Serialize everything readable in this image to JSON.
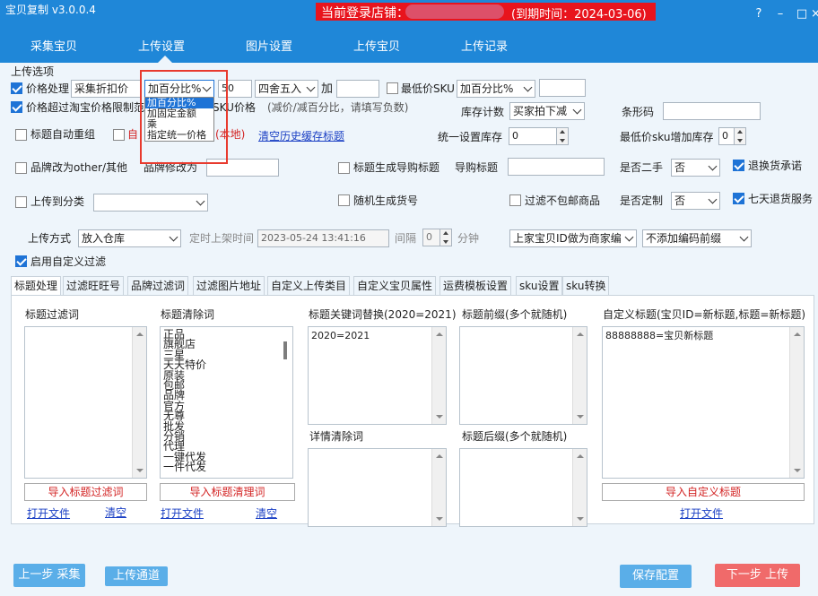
{
  "app": {
    "title": "宝贝复制 v3.0.0.4",
    "login_prefix": "当前登录店铺：",
    "login_expire": "(到期时间：2024-03-06)"
  },
  "nav": [
    "采集宝贝",
    "上传设置",
    "图片设置",
    "上传宝贝",
    "上传记录"
  ],
  "section": "上传选项",
  "price": {
    "label": "价格处理",
    "mode": "采集折扣价",
    "calc": "加百分比%",
    "value": "50",
    "round": "四舍五入",
    "plus_label": "加",
    "plus_value": ""
  },
  "min_sku": {
    "label": "最低价SKU",
    "calc": "加百分比%",
    "value": ""
  },
  "limit": {
    "label_a": "价格超过淘宝价格限制范",
    "label_b": "SKU价格",
    "hint": "(减价/减百分比，请填写负数)"
  },
  "stock": {
    "label": "库存计数",
    "value": "买家拍下减"
  },
  "barcode": {
    "label": "条形码",
    "value": ""
  },
  "dropdown": [
    "加百分比%",
    "加固定金额",
    "乘",
    "指定统一价格"
  ],
  "title_regroup": "标题自动重组",
  "hidden_label": "自",
  "hidden_local": "(本地)",
  "clear_history": "清空历史缓存标题",
  "unify_stock": {
    "label": "统一设置库存",
    "value": "0"
  },
  "min_sku_stock": {
    "label": "最低价sku增加库存",
    "value": "0"
  },
  "brand_other": "品牌改为other/其他",
  "brand_change": {
    "label": "品牌修改为",
    "value": ""
  },
  "guide_title": "标题生成导购标题",
  "guide_label": "导购标题",
  "second_hand": {
    "label": "是否二手",
    "value": "否"
  },
  "return_promise": "退换货承诺",
  "upload_category": "上传到分类",
  "random_code": "随机生成货号",
  "filter_free": "过滤不包邮商品",
  "custom_made": {
    "label": "是否定制",
    "value": "否"
  },
  "seven_days": "七天退货服务",
  "upload_mode": {
    "label": "上传方式",
    "value": "放入仓库",
    "timed_label": "定时上架时间",
    "datetime": "2023-05-24 13:41:16",
    "interval_label": "间隔",
    "interval_value": "0",
    "minute": "分钟"
  },
  "merchant_code": "上家宝贝ID做为商家编",
  "code_prefix": "不添加编码前缀",
  "custom_filter": "启用自定义过滤",
  "tabs": [
    "标题处理",
    "过滤旺旺号",
    "品牌过滤词",
    "过滤图片地址",
    "自定义上传类目",
    "自定义宝贝属性",
    "运费模板设置",
    "sku设置",
    "sku转换"
  ],
  "panels": {
    "filter_words": {
      "title": "标题过滤词",
      "button": "导入标题过滤词",
      "open": "打开文件",
      "clear": "清空"
    },
    "clean_words": {
      "title": "标题清除词",
      "items": [
        "正品",
        "旗舰店",
        "三星",
        "天天特价",
        "原装",
        "包邮",
        "品牌",
        "官方",
        "无尊",
        "批发",
        "分销",
        "代理",
        "一键代发",
        "一件代发"
      ],
      "button": "导入标题清理词",
      "open": "打开文件",
      "clear": "清空"
    },
    "keyword_replace": {
      "title": "标题关键词替换(2020=2021)",
      "content": "2020=2021"
    },
    "prefix": {
      "title": "标题前缀(多个就随机)"
    },
    "detail_clean": {
      "title": "详情清除词"
    },
    "suffix": {
      "title": "标题后缀(多个就随机)"
    },
    "custom_title": {
      "title": "自定义标题(宝贝ID=新标题,标题=新标题)",
      "content": "88888888=宝贝新标题",
      "button": "导入自定义标题",
      "open": "打开文件"
    }
  },
  "bottom": {
    "prev": "上一步 采集",
    "channel": "上传通道",
    "save": "保存配置",
    "next": "下一步 上传"
  },
  "colors": {
    "primary": "#1f87d8",
    "login_bar": "#e8141d",
    "highlight": "#e83a2e",
    "next_btn": "#f06a6a",
    "btn_blue": "#5aaee8"
  }
}
